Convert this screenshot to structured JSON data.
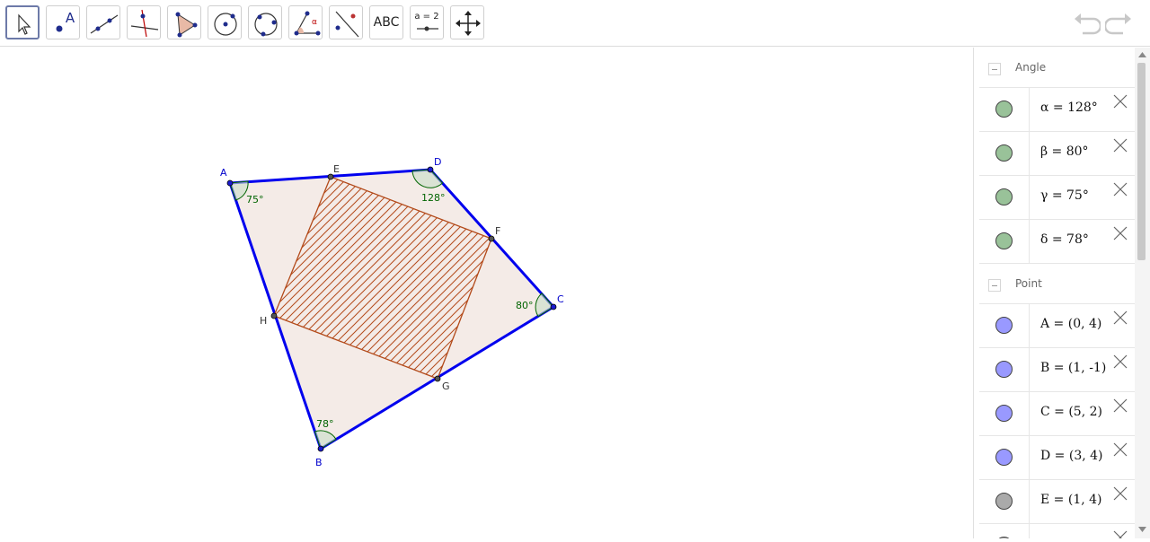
{
  "toolbar": {
    "tools": [
      {
        "name": "move-tool",
        "label": ""
      },
      {
        "name": "point-tool",
        "label": "A"
      },
      {
        "name": "line-tool",
        "label": ""
      },
      {
        "name": "perpendicular-line-tool",
        "label": ""
      },
      {
        "name": "polygon-tool",
        "label": ""
      },
      {
        "name": "circle-center-point-tool",
        "label": ""
      },
      {
        "name": "circle-three-points-tool",
        "label": ""
      },
      {
        "name": "angle-tool",
        "label": "α"
      },
      {
        "name": "reflect-tool",
        "label": ""
      },
      {
        "name": "text-tool",
        "label": "ABC"
      },
      {
        "name": "slider-tool",
        "label": "a = 2"
      },
      {
        "name": "move-graphics-view-tool",
        "label": ""
      }
    ]
  },
  "graphics": {
    "points": [
      {
        "id": "A",
        "label": "A"
      },
      {
        "id": "B",
        "label": "B"
      },
      {
        "id": "C",
        "label": "C"
      },
      {
        "id": "D",
        "label": "D"
      },
      {
        "id": "E",
        "label": "E"
      },
      {
        "id": "F",
        "label": "F"
      },
      {
        "id": "G",
        "label": "G"
      },
      {
        "id": "H",
        "label": "H"
      }
    ],
    "angle_labels": {
      "A": "75°",
      "B": "78°",
      "C": "80°",
      "D": "128°"
    }
  },
  "algebra": {
    "groups": [
      {
        "title": "Angle",
        "items": [
          {
            "definition": "α = 128°",
            "color": "#99c299"
          },
          {
            "definition": "β = 80°",
            "color": "#99c299"
          },
          {
            "definition": "γ = 75°",
            "color": "#99c299"
          },
          {
            "definition": "δ = 78°",
            "color": "#99c299"
          }
        ]
      },
      {
        "title": "Point",
        "items": [
          {
            "definition": "A = (0, 4)",
            "color": "#9999ff"
          },
          {
            "definition": "B = (1, -1)",
            "color": "#9999ff"
          },
          {
            "definition": "C = (5, 2)",
            "color": "#9999ff"
          },
          {
            "definition": "D = (3, 4)",
            "color": "#9999ff"
          },
          {
            "definition": "E = (1, 4)",
            "color": "#aaaaaa"
          }
        ]
      }
    ]
  },
  "colors": {
    "polygon_edge": "#0000ee",
    "fill": "#f4ebe7",
    "hatch": "#b34a1a",
    "angle": "#006400"
  },
  "icons": {
    "undo": "undo-icon",
    "redo": "redo-icon",
    "delete": "close-icon"
  }
}
